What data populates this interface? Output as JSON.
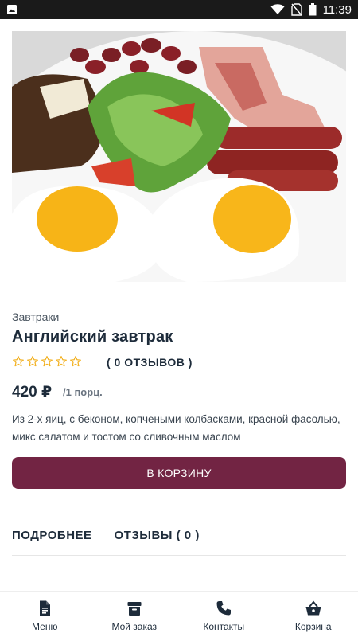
{
  "status_bar": {
    "time": "11:39"
  },
  "product": {
    "image_alt": "Английский завтрак",
    "category": "Завтраки",
    "title": "Английский завтрак",
    "rating": 0,
    "rating_max": 5,
    "reviews_label": "( 0 ОТЗЫВОВ )",
    "price": "420 ₽",
    "portion": "/1 порц.",
    "description": "Из 2-х яиц, с беконом, копчеными колбасками, красной фасолью, микс салатом и тостом со сливочным маслом"
  },
  "actions": {
    "add_to_cart_label": "В КОРЗИНУ"
  },
  "tabs": [
    {
      "label": "ПОДРОБНЕЕ"
    },
    {
      "label": "ОТЗЫВЫ ( 0 )"
    }
  ],
  "bottom_nav": [
    {
      "label": "Меню",
      "icon": "document-icon"
    },
    {
      "label": "Мой заказ",
      "icon": "archive-box-icon"
    },
    {
      "label": "Контакты",
      "icon": "phone-icon"
    },
    {
      "label": "Корзина",
      "icon": "basket-icon"
    }
  ],
  "colors": {
    "accent": "#722443",
    "star": "#f2b01e",
    "text": "#1d2b3a"
  }
}
